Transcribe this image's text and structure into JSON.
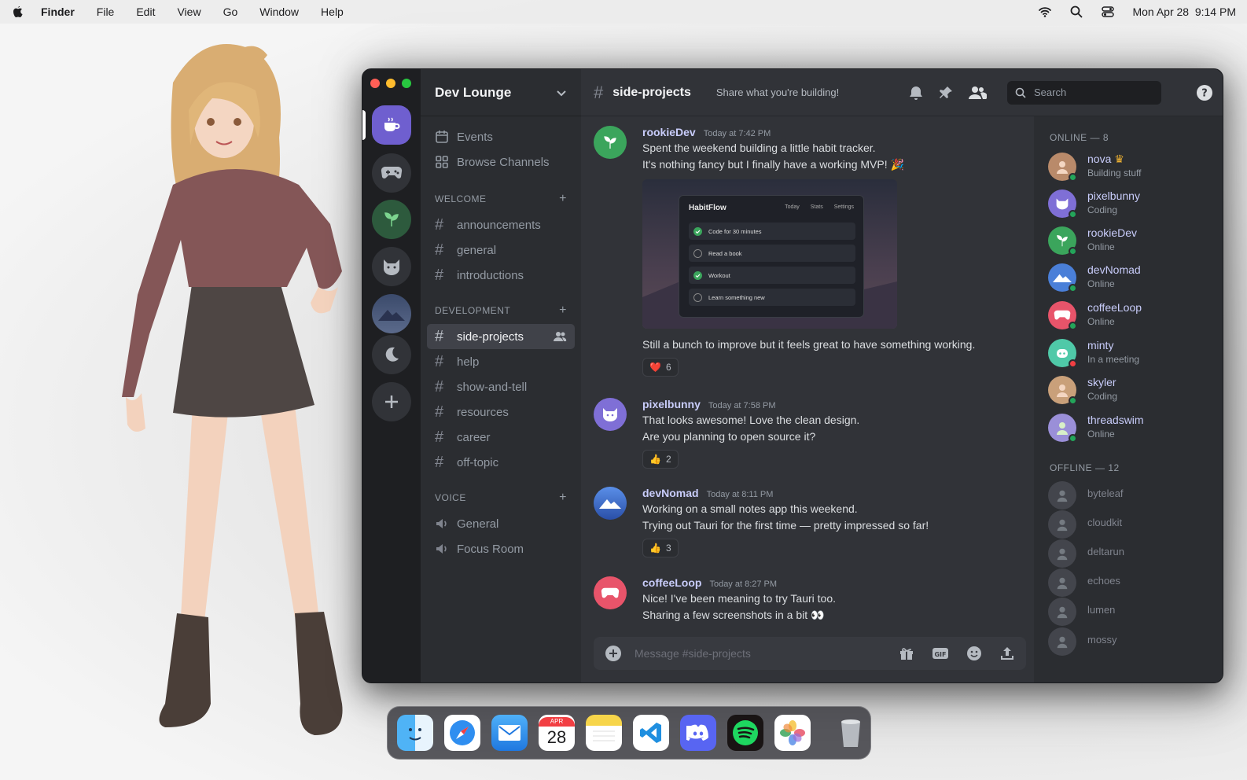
{
  "menubar": {
    "app": "Finder",
    "items": [
      "File",
      "Edit",
      "View",
      "Go",
      "Window",
      "Help"
    ],
    "datetime": "Mon Apr 28  9:14 PM"
  },
  "window": {
    "guild_name": "Dev Lounge",
    "top_links": [
      "Events",
      "Browse Channels"
    ],
    "categories": {
      "welcome": {
        "label": "WELCOME",
        "channels": [
          "announcements",
          "general",
          "introductions"
        ]
      },
      "development": {
        "label": "DEVELOPMENT",
        "channels": [
          "side-projects",
          "help",
          "show-and-tell",
          "resources",
          "career",
          "off-topic"
        ]
      },
      "voice": {
        "label": "VOICE",
        "channels": [
          "General",
          "Focus Room"
        ]
      }
    },
    "channel": {
      "name": "side-projects",
      "topic": "Share what you're building!"
    },
    "search_placeholder": "Search",
    "messages": [
      {
        "author": "rookieDev",
        "time": "Today at 7:42 PM",
        "lines": [
          "Spent the weekend building a little habit tracker.",
          "It's nothing fancy but I finally have a working MVP! 🎉"
        ],
        "after": "Still a bunch to improve but it feels great to have something working.",
        "reaction": {
          "emoji": "❤️",
          "count": "6"
        }
      },
      {
        "author": "pixelbunny",
        "time": "Today at 7:58 PM",
        "lines": [
          "That looks awesome! Love the clean design.",
          "Are you planning to open source it?"
        ],
        "reaction": {
          "emoji": "👍",
          "count": "2"
        }
      },
      {
        "author": "devNomad",
        "time": "Today at 8:11 PM",
        "lines": [
          "Working on a small notes app this weekend.",
          "Trying out Tauri for the first time — pretty impressed so far!"
        ],
        "reaction": {
          "emoji": "👍",
          "count": "3"
        }
      },
      {
        "author": "coffeeLoop",
        "time": "Today at 8:27 PM",
        "lines": [
          "Nice! I've been meaning to try Tauri too.",
          "Sharing a few screenshots in a bit 👀"
        ]
      }
    ],
    "embed": {
      "title": "HabitFlow",
      "nav": [
        "Today",
        "Stats",
        "Settings"
      ],
      "tasks": [
        {
          "label": "Code for 30 minutes",
          "done": true
        },
        {
          "label": "Read a book",
          "done": false
        },
        {
          "label": "Workout",
          "done": true
        },
        {
          "label": "Learn something new",
          "done": false
        }
      ]
    },
    "composer_placeholder": "Message #side-projects",
    "online_label": "ONLINE — 8",
    "offline_label": "OFFLINE — 12",
    "online": [
      {
        "name": "nova",
        "status": "Building stuff",
        "color": "#b98a6a"
      },
      {
        "name": "pixelbunny",
        "status": "Coding",
        "color": "#7f6fd6"
      },
      {
        "name": "rookieDev",
        "status": "Online",
        "color": "#3ba55c"
      },
      {
        "name": "devNomad",
        "status": "Online",
        "color": "#4a7fd8"
      },
      {
        "name": "coffeeLoop",
        "status": "Online",
        "color": "#e8546a"
      },
      {
        "name": "minty",
        "status": "In a meeting",
        "color": "#4fc9a8"
      },
      {
        "name": "skyler",
        "status": "Coding",
        "color": "#c9a07a"
      },
      {
        "name": "threadswim",
        "status": "Online",
        "color": "#9a8fd8"
      }
    ],
    "offline": [
      "byteleaf",
      "cloudkit",
      "deltarun",
      "echoes",
      "lumen",
      "mossy"
    ]
  },
  "dock": {
    "calendar_month": "APR",
    "calendar_day": "28"
  }
}
